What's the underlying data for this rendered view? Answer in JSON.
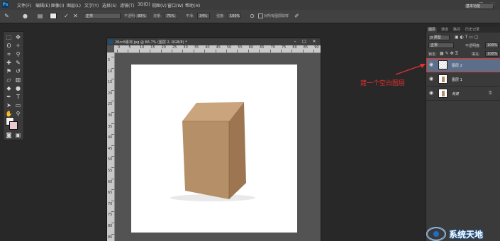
{
  "menubar": {
    "logo": "Ps",
    "items": [
      "文件(F)",
      "编辑(E)",
      "图像(I)",
      "图层(L)",
      "文字(Y)",
      "选择(S)",
      "滤镜(T)",
      "3D(D)",
      "视图(V)",
      "窗口(W)",
      "帮助(H)"
    ],
    "window_controls": [
      "–",
      "□",
      "✕"
    ]
  },
  "options_bar": {
    "mode_select": "正常",
    "opacity_label": "不透明度:",
    "opacity_value": "80%",
    "flow_label": "流量:",
    "flow_value": "75%",
    "smoothing_label": "平滑:",
    "smoothing_value": "34%",
    "pressure_label": "强度:",
    "pressure_value": "100%",
    "sample_all_label": "对所有图层取样",
    "workspace": "基本功能"
  },
  "document": {
    "title": "26cc8素材.jpg @ 66.7% (图层 2, RGB/8) *",
    "ruler_h_labels": [
      "0",
      "5",
      "10",
      "15",
      "20",
      "25",
      "30",
      "35",
      "40",
      "45",
      "50",
      "55",
      "60",
      "65",
      "70",
      "75",
      "80",
      "85",
      "90"
    ],
    "ruler_v_labels": [
      "5",
      "10",
      "15",
      "20",
      "25",
      "30",
      "35",
      "40",
      "45",
      "50",
      "55",
      "60",
      "65",
      "70",
      "75",
      "80",
      "85"
    ]
  },
  "layers_panel": {
    "tabs": [
      "图层",
      "通道",
      "路径",
      "历史记录"
    ],
    "kind_filter": "ρ 类型",
    "blend_mode": "正常",
    "opacity_label": "不透明度:",
    "opacity_value": "100%",
    "lock_label": "锁定:",
    "fill_label": "填充:",
    "fill_value": "100%",
    "layers": [
      {
        "name": "图层 2",
        "selected": true
      },
      {
        "name": "图层 1",
        "selected": false
      },
      {
        "name": "背景",
        "selected": false
      }
    ]
  },
  "annotation": {
    "text": "建一个空白图层",
    "color": "#e53030"
  },
  "watermark": {
    "text": "系统天地"
  },
  "colors": {
    "app_bg": "#282828",
    "selected_layer": "#5b6e8a",
    "highlight_outline": "#d93a2b",
    "box_kraft": "#b58f68"
  },
  "icons": [
    "ps-logo-icon",
    "brush-tool-icon",
    "move-tool-icon",
    "marquee-tool-icon",
    "lasso-tool-icon",
    "crop-tool-icon",
    "eyedropper-tool-icon",
    "stamp-tool-icon",
    "eraser-tool-icon",
    "gradient-tool-icon",
    "pen-tool-icon",
    "text-tool-icon",
    "path-select-icon",
    "hand-tool-icon",
    "zoom-tool-icon",
    "eye-icon",
    "lock-icon"
  ]
}
